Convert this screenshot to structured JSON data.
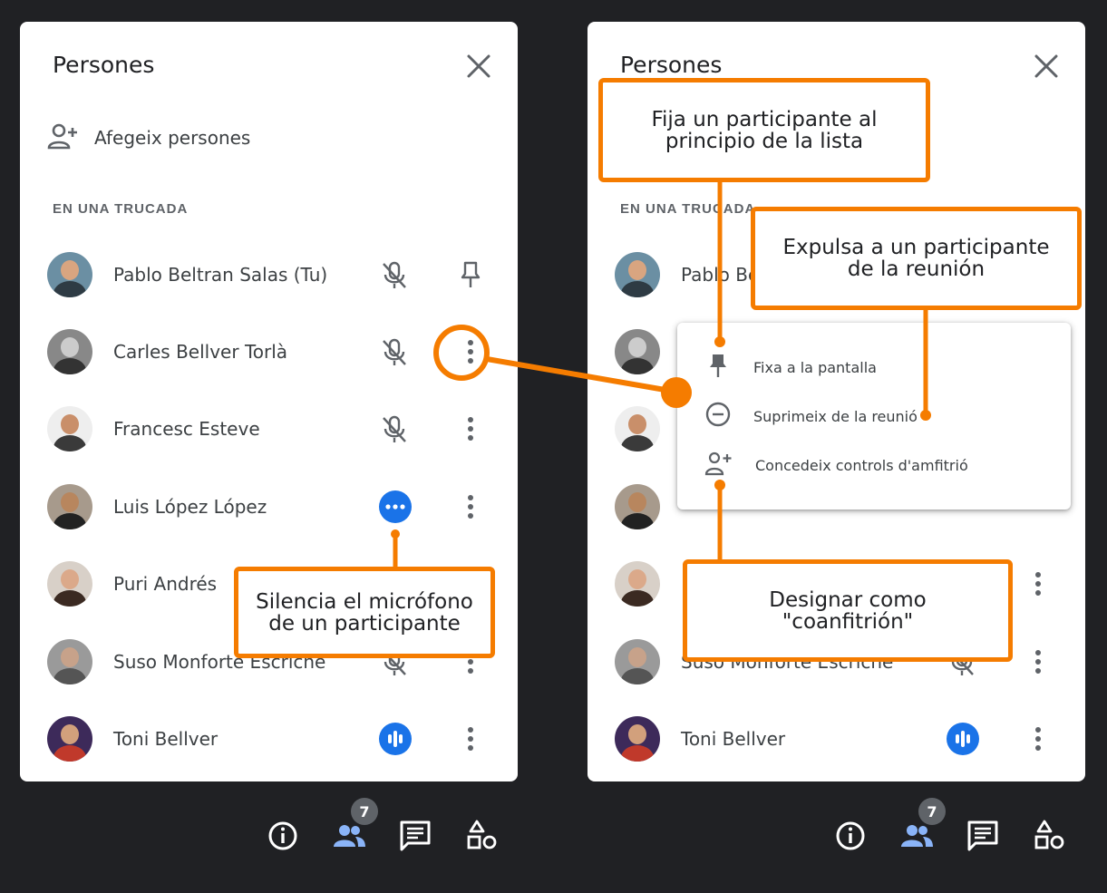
{
  "left_panel": {
    "title": "Persones",
    "add_people_label": "Afegeix persones",
    "section_label": "EN UNA TRUCADA",
    "participants": [
      {
        "name": "Pablo Beltran Salas (Tu)",
        "status": "mic-off-icon",
        "action": "pin-icon"
      },
      {
        "name": "Carles Bellver Torlà",
        "status": "mic-off-icon",
        "action": "more-vert-icon"
      },
      {
        "name": "Francesc Esteve",
        "status": "mic-off-icon",
        "action": "more-vert-icon"
      },
      {
        "name": "Luis López López",
        "status": "more-horiz-icon",
        "action": "more-vert-icon"
      },
      {
        "name": "Puri Andrés",
        "status": "",
        "action": "more-vert-icon"
      },
      {
        "name": "Suso Monforte Escriche",
        "status": "mic-off-icon",
        "action": "more-vert-icon"
      },
      {
        "name": "Toni Bellver",
        "status": "audio-level-icon",
        "action": "more-vert-icon"
      }
    ],
    "callout_mute": "Silencia el micrófono\nde un participante"
  },
  "right_panel": {
    "title": "Persones",
    "section_label": "EN UNA TRUCADA",
    "visible_names": [
      "Pablo Be",
      "Suso Monforte Escriche",
      "Toni Bellver"
    ],
    "menu": [
      {
        "label": "Fixa a la pantalla",
        "icon": "pin-icon"
      },
      {
        "label": "Suprimeix de la reunió",
        "icon": "remove-circle-icon"
      },
      {
        "label": "Concedeix controls d'amfitrió",
        "icon": "person-add-icon"
      }
    ],
    "callout_pin": "Fija un participante al\nprincipio de la lista",
    "callout_remove": "Expulsa a un participante\nde la reunión",
    "callout_cohost": "Designar como\n\"coanfitrión\""
  },
  "toolbar": {
    "people_count": "7",
    "icons": [
      "info-icon",
      "people-icon",
      "chat-icon",
      "activities-icon"
    ]
  },
  "colors": {
    "accent_orange": "#f57c00",
    "google_blue": "#1a73e8",
    "toolbar_bg": "#202124"
  }
}
